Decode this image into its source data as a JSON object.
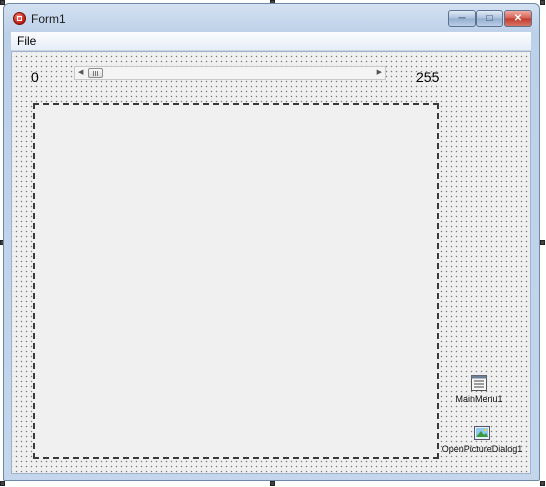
{
  "window": {
    "title": "Form1"
  },
  "menu": {
    "items": [
      "File"
    ]
  },
  "trackbar": {
    "min_label": "0",
    "max_label": "255",
    "position": 4
  },
  "components": [
    {
      "name": "MainMenu1",
      "icon": "main-menu-icon"
    },
    {
      "name": "OpenPictureDialog1",
      "icon": "open-picture-dialog-icon"
    }
  ],
  "colors": {
    "titlebar": "#bcd0e8",
    "close_button": "#c03a2b",
    "client": "#f0f0f0"
  }
}
